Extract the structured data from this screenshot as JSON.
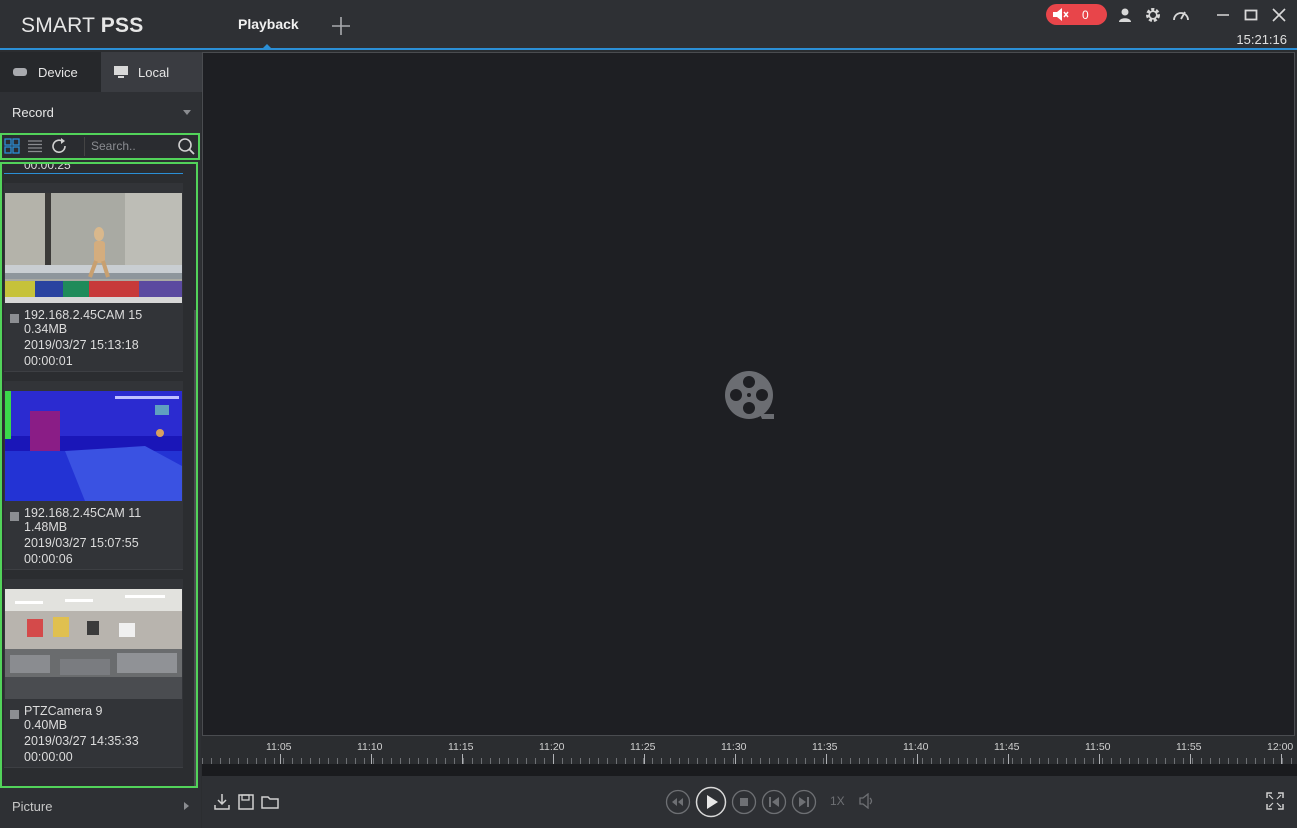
{
  "app": {
    "logo_light": "SMART",
    "logo_bold": "PSS",
    "clock": "15:21:16",
    "alarm_count": "0"
  },
  "tabs": [
    {
      "label": "Playback",
      "active": true
    }
  ],
  "sidebar": {
    "source_tabs": [
      {
        "label": "Device"
      },
      {
        "label": "Local"
      }
    ],
    "record_select": "Record",
    "search": {
      "placeholder": "Search.."
    },
    "partial_item_duration": "00:00:25",
    "records": [
      {
        "camera": "192.168.2.45CAM 15",
        "size": "0.34MB",
        "datetime": "2019/03/27 15:13:18",
        "duration": "00:00:01"
      },
      {
        "camera": "192.168.2.45CAM 11",
        "size": "1.48MB",
        "datetime": "2019/03/27 15:07:55",
        "duration": "00:00:06"
      },
      {
        "camera": "PTZCamera 9",
        "size": "0.40MB",
        "datetime": "2019/03/27 14:35:33",
        "duration": "00:00:00"
      }
    ],
    "picture_label": "Picture"
  },
  "timeline": {
    "ticks": [
      "11:05",
      "11:10",
      "11:15",
      "11:20",
      "11:25",
      "11:30",
      "11:35",
      "11:40",
      "11:45",
      "11:50",
      "11:55",
      "12:00"
    ]
  },
  "controls": {
    "speed": "1X"
  },
  "colors": {
    "accent": "#2b8fd6",
    "alarm": "#e8454a",
    "highlight": "#52d35a",
    "background": "#2b2d30",
    "video": "#1e1f23"
  }
}
